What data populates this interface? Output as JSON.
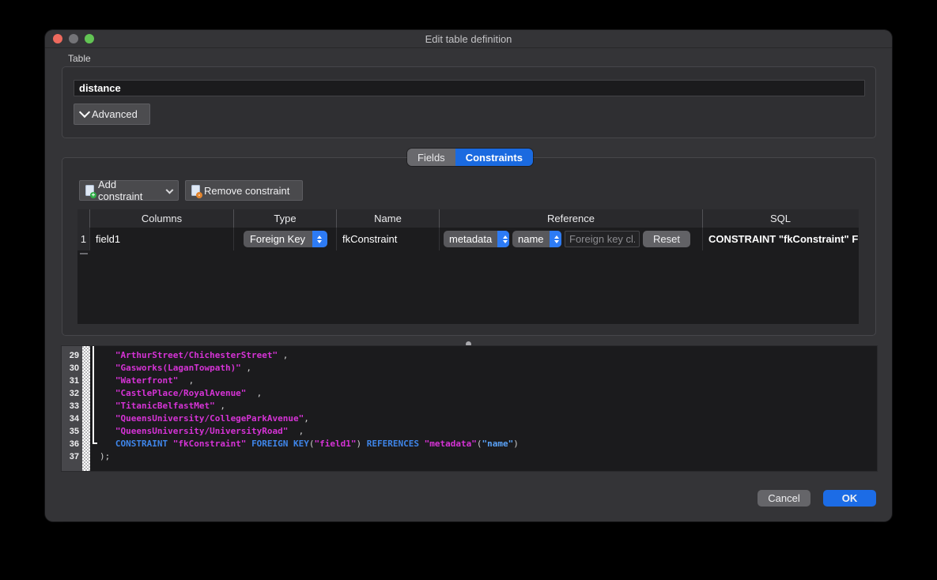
{
  "window": {
    "title": "Edit table definition"
  },
  "table_group": {
    "label": "Table",
    "table_name": "distance",
    "advanced_label": "Advanced"
  },
  "tabs": {
    "fields": "Fields",
    "constraints": "Constraints"
  },
  "toolbar": {
    "add_label": "Add constraint",
    "remove_label": "Remove constraint"
  },
  "grid": {
    "headers": [
      "Columns",
      "Type",
      "Name",
      "Reference",
      "SQL"
    ],
    "row": {
      "num": "1",
      "columns": "field1",
      "type": "Foreign Key",
      "name": "fkConstraint",
      "ref_table": "metadata",
      "ref_column": "name",
      "clause_placeholder": "Foreign key cl...",
      "reset_label": "Reset",
      "sql": "CONSTRAINT \"fkConstraint\" FO"
    }
  },
  "editor": {
    "lines": [
      {
        "num": "29",
        "segments": [
          {
            "c": "str",
            "t": "   \"ArthurStreet/ChichesterStreet\""
          },
          {
            "c": "pun",
            "t": " ,"
          }
        ]
      },
      {
        "num": "30",
        "segments": [
          {
            "c": "str",
            "t": "   \"Gasworks(LaganTowpath)\""
          },
          {
            "c": "pun",
            "t": " ,"
          }
        ]
      },
      {
        "num": "31",
        "segments": [
          {
            "c": "str",
            "t": "   \"Waterfront\""
          },
          {
            "c": "pun",
            "t": "  ,"
          }
        ]
      },
      {
        "num": "32",
        "segments": [
          {
            "c": "str",
            "t": "   \"CastlePlace/RoyalAvenue\""
          },
          {
            "c": "pun",
            "t": "  ,"
          }
        ]
      },
      {
        "num": "33",
        "segments": [
          {
            "c": "str",
            "t": "   \"TitanicBelfastMet\""
          },
          {
            "c": "pun",
            "t": " ,"
          }
        ]
      },
      {
        "num": "34",
        "segments": [
          {
            "c": "str",
            "t": "   \"QueensUniversity/CollegeParkAvenue\""
          },
          {
            "c": "pun",
            "t": ","
          }
        ]
      },
      {
        "num": "35",
        "segments": [
          {
            "c": "str",
            "t": "   \"QueensUniversity/UniversityRoad\""
          },
          {
            "c": "pun",
            "t": "  ,"
          }
        ]
      },
      {
        "num": "36",
        "segments": [
          {
            "c": "kw",
            "t": "   CONSTRAINT"
          },
          {
            "c": "pun",
            "t": " "
          },
          {
            "c": "str",
            "t": "\"fkConstraint\""
          },
          {
            "c": "pun",
            "t": " "
          },
          {
            "c": "kw",
            "t": "FOREIGN KEY"
          },
          {
            "c": "pun",
            "t": "("
          },
          {
            "c": "str",
            "t": "\"field1\""
          },
          {
            "c": "pun",
            "t": ") "
          },
          {
            "c": "kw",
            "t": "REFERENCES"
          },
          {
            "c": "pun",
            "t": " "
          },
          {
            "c": "str",
            "t": "\"metadata\""
          },
          {
            "c": "pun",
            "t": "("
          },
          {
            "c": "ref",
            "t": "\"name\""
          },
          {
            "c": "pun",
            "t": ")"
          }
        ]
      },
      {
        "num": "37",
        "segments": [
          {
            "c": "pun",
            "t": ");"
          }
        ]
      }
    ]
  },
  "footer": {
    "cancel_label": "Cancel",
    "ok_label": "OK"
  },
  "colors": {
    "accent_blue": "#1a6ae0",
    "popup_stepper_blue": "#2d7bf5",
    "string_magenta": "#d633d6",
    "keyword_blue": "#3f86ea",
    "reference_blue": "#5aa2f7",
    "traffic_red": "#ee6a5e",
    "traffic_gray": "#737377",
    "traffic_green": "#62c454"
  }
}
